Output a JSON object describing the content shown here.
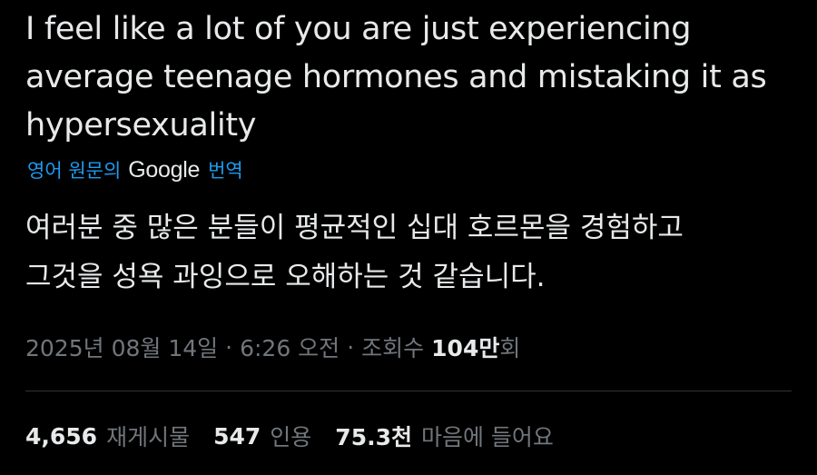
{
  "tweet": {
    "text": "I feel like a lot of you are just experiencing\naverage teenage hormones and mistaking it as\nhypersexuality",
    "translate_prefix": "영어 원문의",
    "translate_brand": "Google",
    "translate_suffix": "번역",
    "translated_text": "여러분 중 많은 분들이 평균적인 십대 호르몬을 경험하고\n그것을 성욕 과잉으로 오해하는 것 같습니다.",
    "date": "2025년 08월 14일",
    "separator": "·",
    "time": "6:26 오전",
    "views_label": "조회수",
    "views_count": "104만",
    "views_suffix": "회"
  },
  "stats": {
    "retweets_count": "4,656",
    "retweets_label": "재게시물",
    "quotes_count": "547",
    "quotes_label": "인용",
    "likes_count": "75.3천",
    "likes_label": "마음에 들어요"
  },
  "colors": {
    "background": "#000000",
    "text": "#e7e9ea",
    "muted": "#71767b",
    "link": "#1d9bf0",
    "divider": "#2f3336"
  }
}
